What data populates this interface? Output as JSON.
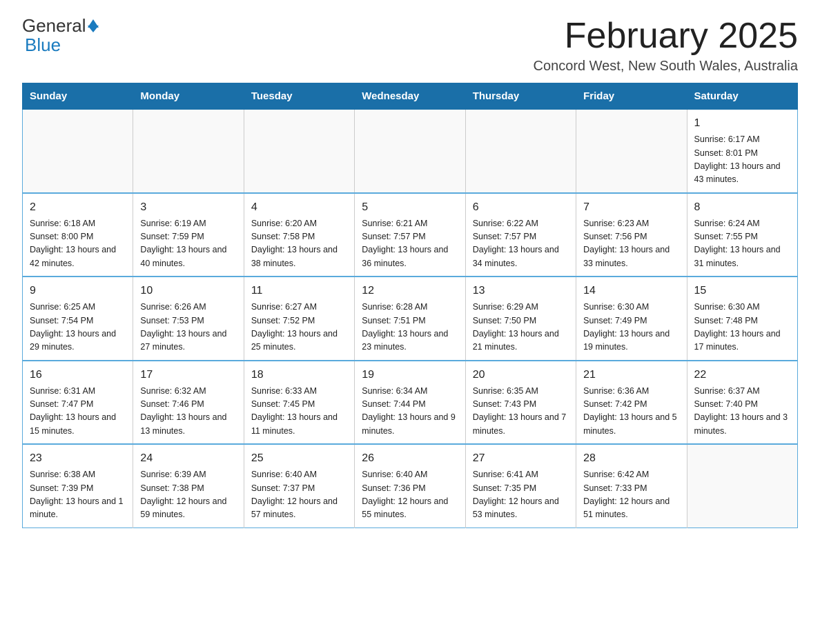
{
  "logo": {
    "general": "General",
    "blue": "Blue"
  },
  "title": {
    "month": "February 2025",
    "location": "Concord West, New South Wales, Australia"
  },
  "weekdays": [
    "Sunday",
    "Monday",
    "Tuesday",
    "Wednesday",
    "Thursday",
    "Friday",
    "Saturday"
  ],
  "weeks": [
    [
      {
        "day": "",
        "info": ""
      },
      {
        "day": "",
        "info": ""
      },
      {
        "day": "",
        "info": ""
      },
      {
        "day": "",
        "info": ""
      },
      {
        "day": "",
        "info": ""
      },
      {
        "day": "",
        "info": ""
      },
      {
        "day": "1",
        "info": "Sunrise: 6:17 AM\nSunset: 8:01 PM\nDaylight: 13 hours and 43 minutes."
      }
    ],
    [
      {
        "day": "2",
        "info": "Sunrise: 6:18 AM\nSunset: 8:00 PM\nDaylight: 13 hours and 42 minutes."
      },
      {
        "day": "3",
        "info": "Sunrise: 6:19 AM\nSunset: 7:59 PM\nDaylight: 13 hours and 40 minutes."
      },
      {
        "day": "4",
        "info": "Sunrise: 6:20 AM\nSunset: 7:58 PM\nDaylight: 13 hours and 38 minutes."
      },
      {
        "day": "5",
        "info": "Sunrise: 6:21 AM\nSunset: 7:57 PM\nDaylight: 13 hours and 36 minutes."
      },
      {
        "day": "6",
        "info": "Sunrise: 6:22 AM\nSunset: 7:57 PM\nDaylight: 13 hours and 34 minutes."
      },
      {
        "day": "7",
        "info": "Sunrise: 6:23 AM\nSunset: 7:56 PM\nDaylight: 13 hours and 33 minutes."
      },
      {
        "day": "8",
        "info": "Sunrise: 6:24 AM\nSunset: 7:55 PM\nDaylight: 13 hours and 31 minutes."
      }
    ],
    [
      {
        "day": "9",
        "info": "Sunrise: 6:25 AM\nSunset: 7:54 PM\nDaylight: 13 hours and 29 minutes."
      },
      {
        "day": "10",
        "info": "Sunrise: 6:26 AM\nSunset: 7:53 PM\nDaylight: 13 hours and 27 minutes."
      },
      {
        "day": "11",
        "info": "Sunrise: 6:27 AM\nSunset: 7:52 PM\nDaylight: 13 hours and 25 minutes."
      },
      {
        "day": "12",
        "info": "Sunrise: 6:28 AM\nSunset: 7:51 PM\nDaylight: 13 hours and 23 minutes."
      },
      {
        "day": "13",
        "info": "Sunrise: 6:29 AM\nSunset: 7:50 PM\nDaylight: 13 hours and 21 minutes."
      },
      {
        "day": "14",
        "info": "Sunrise: 6:30 AM\nSunset: 7:49 PM\nDaylight: 13 hours and 19 minutes."
      },
      {
        "day": "15",
        "info": "Sunrise: 6:30 AM\nSunset: 7:48 PM\nDaylight: 13 hours and 17 minutes."
      }
    ],
    [
      {
        "day": "16",
        "info": "Sunrise: 6:31 AM\nSunset: 7:47 PM\nDaylight: 13 hours and 15 minutes."
      },
      {
        "day": "17",
        "info": "Sunrise: 6:32 AM\nSunset: 7:46 PM\nDaylight: 13 hours and 13 minutes."
      },
      {
        "day": "18",
        "info": "Sunrise: 6:33 AM\nSunset: 7:45 PM\nDaylight: 13 hours and 11 minutes."
      },
      {
        "day": "19",
        "info": "Sunrise: 6:34 AM\nSunset: 7:44 PM\nDaylight: 13 hours and 9 minutes."
      },
      {
        "day": "20",
        "info": "Sunrise: 6:35 AM\nSunset: 7:43 PM\nDaylight: 13 hours and 7 minutes."
      },
      {
        "day": "21",
        "info": "Sunrise: 6:36 AM\nSunset: 7:42 PM\nDaylight: 13 hours and 5 minutes."
      },
      {
        "day": "22",
        "info": "Sunrise: 6:37 AM\nSunset: 7:40 PM\nDaylight: 13 hours and 3 minutes."
      }
    ],
    [
      {
        "day": "23",
        "info": "Sunrise: 6:38 AM\nSunset: 7:39 PM\nDaylight: 13 hours and 1 minute."
      },
      {
        "day": "24",
        "info": "Sunrise: 6:39 AM\nSunset: 7:38 PM\nDaylight: 12 hours and 59 minutes."
      },
      {
        "day": "25",
        "info": "Sunrise: 6:40 AM\nSunset: 7:37 PM\nDaylight: 12 hours and 57 minutes."
      },
      {
        "day": "26",
        "info": "Sunrise: 6:40 AM\nSunset: 7:36 PM\nDaylight: 12 hours and 55 minutes."
      },
      {
        "day": "27",
        "info": "Sunrise: 6:41 AM\nSunset: 7:35 PM\nDaylight: 12 hours and 53 minutes."
      },
      {
        "day": "28",
        "info": "Sunrise: 6:42 AM\nSunset: 7:33 PM\nDaylight: 12 hours and 51 minutes."
      },
      {
        "day": "",
        "info": ""
      }
    ]
  ]
}
